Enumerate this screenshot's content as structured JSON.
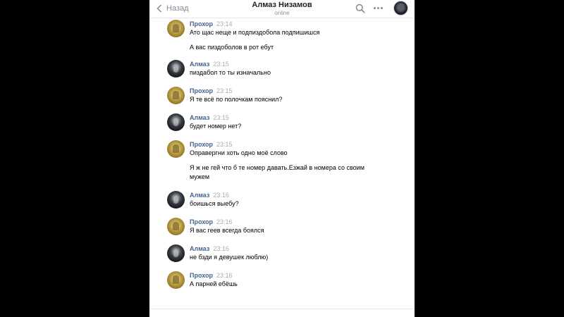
{
  "header": {
    "back_label": "Назад",
    "contact_name": "Алмаз Низамов",
    "status": "online"
  },
  "messages": [
    {
      "author": "Прохор",
      "time": "23:14",
      "avatar": "gold-avatar",
      "lines": [
        "Ато щас неще и подпиздобола подпишишся",
        "А вас пиздоболов в рот ебут"
      ]
    },
    {
      "author": "Алмаз",
      "time": "23:15",
      "avatar": "dark-avatar",
      "lines": [
        "пиздабол то ты изначально"
      ]
    },
    {
      "author": "Прохор",
      "time": "23:15",
      "avatar": "gold-avatar",
      "lines": [
        "Я те всё по полочкам пояснил?"
      ]
    },
    {
      "author": "Алмаз",
      "time": "23:15",
      "avatar": "dark-avatar",
      "lines": [
        "будет номер нет?"
      ]
    },
    {
      "author": "Прохор",
      "time": "23:15",
      "avatar": "gold-avatar",
      "lines": [
        "Оправергни хоть одно моё слово",
        "Я ж не гей что б те номер давать.Езжай в номера со своим мужем"
      ]
    },
    {
      "author": "Алмаз",
      "time": "23:16",
      "avatar": "dark-avatar",
      "lines": [
        "боишься выебу?"
      ]
    },
    {
      "author": "Прохор",
      "time": "23:16",
      "avatar": "gold-avatar",
      "lines": [
        "Я вас геев всегда боялся"
      ]
    },
    {
      "author": "Алмаз",
      "time": "23:16",
      "avatar": "dark-avatar",
      "lines": [
        "не бзди я девушек люблю)"
      ]
    },
    {
      "author": "Прохор",
      "time": "23:16",
      "avatar": "gold-avatar",
      "lines": [
        "А парней ебёшь"
      ]
    }
  ]
}
